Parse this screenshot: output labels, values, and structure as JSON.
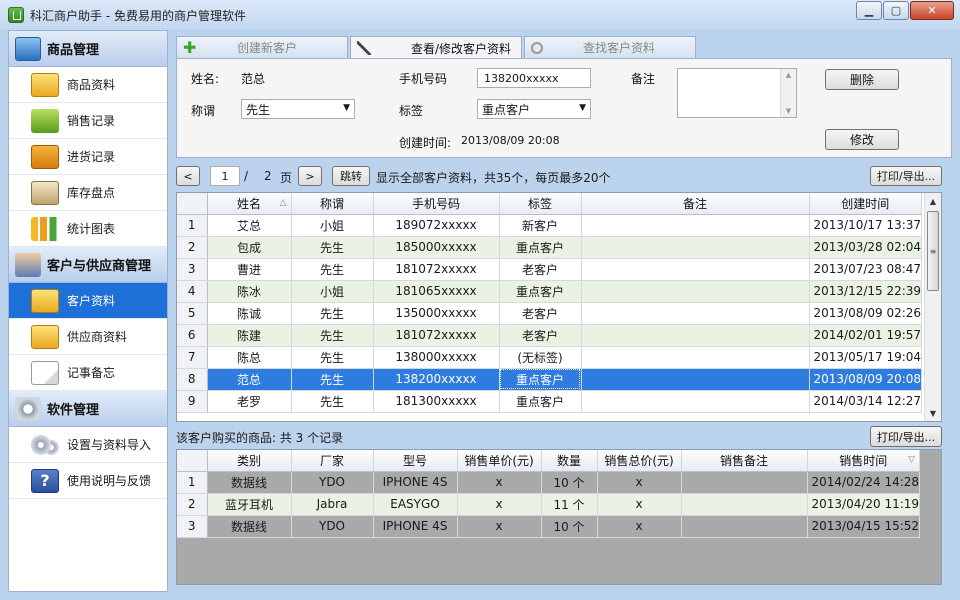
{
  "window": {
    "title": "科汇商户助手 - 免费易用的商户管理软件",
    "min_glyph": "▁",
    "max_glyph": "▢",
    "close_glyph": "✕"
  },
  "sidebar": {
    "sections": [
      {
        "title": "商品管理",
        "icon": "monitor-icon",
        "items": [
          {
            "label": "商品资料",
            "icon": "folder-icon"
          },
          {
            "label": "销售记录",
            "icon": "leaf-icon"
          },
          {
            "label": "进货记录",
            "icon": "truck-icon"
          },
          {
            "label": "库存盘点",
            "icon": "house-icon"
          },
          {
            "label": "统计图表",
            "icon": "bar-chart-icon"
          }
        ]
      },
      {
        "title": "客户与供应商管理",
        "icon": "people-icon",
        "items": [
          {
            "label": "客户资料",
            "icon": "folder-icon",
            "selected": true
          },
          {
            "label": "供应商资料",
            "icon": "folder-icon"
          },
          {
            "label": "记事备忘",
            "icon": "note-icon"
          }
        ]
      },
      {
        "title": "软件管理",
        "icon": "gear-icon",
        "items": [
          {
            "label": "设置与资料导入",
            "icon": "gears-icon"
          },
          {
            "label": "使用说明与反馈",
            "icon": "help-icon"
          }
        ]
      }
    ]
  },
  "tabs": {
    "create": "创建新客户",
    "view": "查看/修改客户资料",
    "search": "查找客户资料",
    "active": "view"
  },
  "form": {
    "name_label": "姓名:",
    "name_value": "范总",
    "phone_label": "手机号码",
    "phone_value": "138200xxxxx",
    "note_label": "备注",
    "title_label": "称谓",
    "title_value": "先生",
    "tag_label": "标签",
    "tag_value": "重点客户",
    "created_label": "创建时间:",
    "created_value": "2013/08/09 20:08",
    "delete_button": "删除",
    "modify_button": "修改"
  },
  "pager": {
    "prev": "<",
    "current": "1",
    "slash": "/",
    "total": "2",
    "page_unit": "页",
    "next": ">",
    "jump": "跳转",
    "summary": "显示全部客户资料，共35个，每页最多20个",
    "export": "打印/导出..."
  },
  "customers": {
    "columns": [
      "",
      "姓名",
      "称谓",
      "手机号码",
      "标签",
      "备注",
      "创建时间"
    ],
    "sort_mark": "△",
    "rows": [
      [
        "1",
        "艾总",
        "小姐",
        "189072xxxxx",
        "新客户",
        "",
        "2013/10/17 13:37"
      ],
      [
        "2",
        "包成",
        "先生",
        "185000xxxxx",
        "重点客户",
        "",
        "2013/03/28 02:04"
      ],
      [
        "3",
        "曹进",
        "先生",
        "181072xxxxx",
        "老客户",
        "",
        "2013/07/23 08:47"
      ],
      [
        "4",
        "陈冰",
        "小姐",
        "181065xxxxx",
        "重点客户",
        "",
        "2013/12/15 22:39"
      ],
      [
        "5",
        "陈诚",
        "先生",
        "135000xxxxx",
        "老客户",
        "",
        "2013/08/09 02:26"
      ],
      [
        "6",
        "陈建",
        "先生",
        "181072xxxxx",
        "老客户",
        "",
        "2014/02/01 19:57"
      ],
      [
        "7",
        "陈总",
        "先生",
        "138000xxxxx",
        "(无标签)",
        "",
        "2013/05/17 19:04"
      ],
      [
        "8",
        "范总",
        "先生",
        "138200xxxxx",
        "重点客户",
        "",
        "2013/08/09 20:08"
      ],
      [
        "9",
        "老罗",
        "先生",
        "181300xxxxx",
        "重点客户",
        "",
        "2014/03/14 12:27"
      ]
    ],
    "selected_row": "8"
  },
  "purchases": {
    "title": "该客户购买的商品: 共 3 个记录",
    "export": "打印/导出...",
    "columns": [
      "",
      "类别",
      "厂家",
      "型号",
      "销售单价(元)",
      "数量",
      "销售总价(元)",
      "销售备注",
      "销售时间"
    ],
    "sort_mark": "▽",
    "rows": [
      [
        "1",
        "数据线",
        "YDO",
        "IPHONE 4S",
        "x",
        "10 个",
        "x",
        "",
        "2014/02/24 14:28"
      ],
      [
        "2",
        "蓝牙耳机",
        "Jabra",
        "EASYGO",
        "x",
        "11 个",
        "x",
        "",
        "2013/04/20 11:19"
      ],
      [
        "3",
        "数据线",
        "YDO",
        "IPHONE 4S",
        "x",
        "10 个",
        "x",
        "",
        "2013/04/15 15:52"
      ]
    ]
  }
}
